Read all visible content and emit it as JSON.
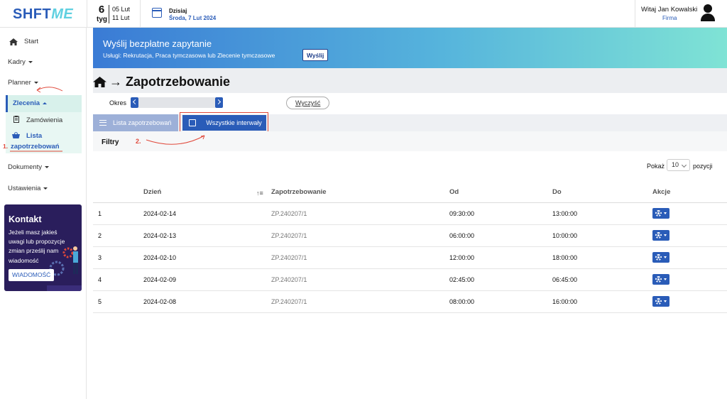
{
  "header": {
    "logo_a": "SHFT",
    "logo_b": "ME",
    "week_number": "6",
    "week_label": "tyg",
    "week_start": "05 Lut",
    "week_end": "11 Lut",
    "today_label": "Dzisiaj",
    "today_date": "Środa, 7 Lut 2024",
    "greeting": "Witaj Jan Kowalski",
    "company": "Firma"
  },
  "sidebar": {
    "start": "Start",
    "kadry": "Kadry",
    "planner": "Planner",
    "zlecenia": "Zlecenia",
    "zamowienia": "Zamówienia",
    "lista_1": "Lista",
    "lista_2": "zapotrzebowań",
    "annotation_1": "1.",
    "dokumenty": "Dokumenty",
    "ustawienia": "Ustawienia",
    "kontakt_title": "Kontakt",
    "kontakt_text": "Jeżeli masz jakieś uwagi lub propozycje zmian prześlij nam wiadomość",
    "kontakt_button": "WIADOMOŚĆ"
  },
  "banner": {
    "title": "Wyślij bezpłatne zapytanie",
    "services": "Usługi: Rekrutacja, Praca tymczasowa lub Zlecenie tymczasowe",
    "send_button": "Wyślij"
  },
  "page": {
    "arrow": "→",
    "title": "Zapotrzebowanie",
    "okres_label": "Okres",
    "clear_button": "Wyczyść",
    "tab_list": "Lista zapotrzebowań",
    "tab_all": "Wszystkie interwały",
    "annotation_2": "2.",
    "filters": "Filtry",
    "show_label": "Pokaż",
    "show_value": "10",
    "show_suffix": "pozycji"
  },
  "table": {
    "headers": [
      "Dzień",
      "Zapotrzebowanie",
      "Od",
      "Do",
      "Akcje"
    ],
    "rows": [
      {
        "no": "1",
        "day": "2024-02-14",
        "zp": "ZP.240207/1",
        "od": "09:30:00",
        "do": "13:00:00"
      },
      {
        "no": "2",
        "day": "2024-02-13",
        "zp": "ZP.240207/1",
        "od": "06:00:00",
        "do": "10:00:00"
      },
      {
        "no": "3",
        "day": "2024-02-10",
        "zp": "ZP.240207/1",
        "od": "12:00:00",
        "do": "18:00:00"
      },
      {
        "no": "4",
        "day": "2024-02-09",
        "zp": "ZP.240207/1",
        "od": "02:45:00",
        "do": "06:45:00"
      },
      {
        "no": "5",
        "day": "2024-02-08",
        "zp": "ZP.240207/1",
        "od": "08:00:00",
        "do": "16:00:00"
      }
    ]
  },
  "colors": {
    "brand_blue": "#2a5cb8",
    "brand_cyan": "#5fd0e0",
    "annotation_red": "#e0483a",
    "submenu_bg": "#e8f7f3",
    "kontakt_bg": "#2a1e5c"
  },
  "icons": [
    "home-icon",
    "calendar-icon",
    "user-icon",
    "list-icon",
    "calendar-check-icon",
    "basket-icon",
    "clipboard-icon",
    "gear-icon",
    "sort-icon",
    "chevron-left-icon",
    "chevron-right-icon"
  ]
}
